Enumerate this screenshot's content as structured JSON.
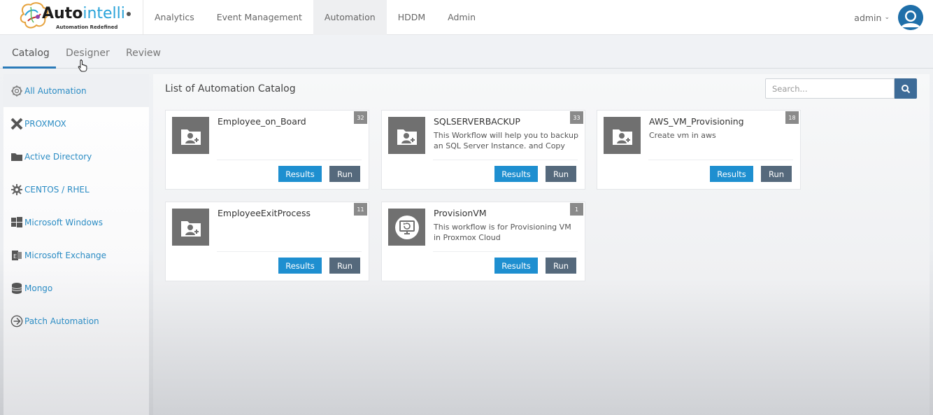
{
  "brand": {
    "name_bold": "Auto",
    "name_light": "intelli",
    "tagline": "Automation Redefined"
  },
  "nav": {
    "items": [
      "Analytics",
      "Event Management",
      "Automation",
      "HDDM",
      "Admin"
    ],
    "active": "Automation"
  },
  "user": {
    "name": "admin",
    "caret": "⌄"
  },
  "subtabs": {
    "items": [
      "Catalog",
      "Designer",
      "Review"
    ],
    "active": "Catalog"
  },
  "sidebar": {
    "items": [
      {
        "label": "All Automation",
        "icon": "gear-cluster-icon"
      },
      {
        "label": "PROXMOX",
        "icon": "proxmox-icon"
      },
      {
        "label": "Active Directory",
        "icon": "folder-icon"
      },
      {
        "label": "CENTOS / RHEL",
        "icon": "centos-icon"
      },
      {
        "label": "Microsoft Windows",
        "icon": "windows-icon"
      },
      {
        "label": "Microsoft Exchange",
        "icon": "exchange-icon"
      },
      {
        "label": "Mongo",
        "icon": "database-icon"
      },
      {
        "label": "Patch Automation",
        "icon": "patch-icon"
      }
    ]
  },
  "main": {
    "title": "List of Automation Catalog",
    "search_placeholder": "Search..."
  },
  "cards": [
    {
      "title": "Employee_on_Board",
      "description": "",
      "count": "32",
      "icon": "user-folder-icon",
      "results_label": "Results",
      "run_label": "Run"
    },
    {
      "title": "SQLSERVERBACKUP",
      "description": "This Workflow will help you to backup an SQL Server Instance. and Copy the...",
      "count": "33",
      "icon": "user-folder-icon",
      "results_label": "Results",
      "run_label": "Run"
    },
    {
      "title": "AWS_VM_Provisioning",
      "description": "Create vm in aws",
      "count": "18",
      "icon": "user-folder-icon",
      "results_label": "Results",
      "run_label": "Run"
    },
    {
      "title": "EmployeeExitProcess",
      "description": "",
      "count": "11",
      "icon": "user-folder-icon",
      "results_label": "Results",
      "run_label": "Run"
    },
    {
      "title": "ProvisionVM",
      "description": "This workflow is for Provisioning VM in Proxmox Cloud",
      "count": "1",
      "icon": "monitor-refresh-icon",
      "results_label": "Results",
      "run_label": "Run"
    }
  ],
  "colors": {
    "accent_blue": "#1e8fd0",
    "run_slate": "#55697c",
    "link_blue": "#2b8cc4",
    "underline": "#2b7bb9"
  }
}
